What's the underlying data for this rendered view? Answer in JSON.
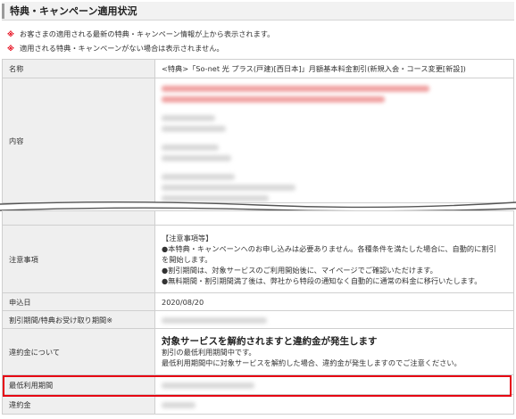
{
  "title": "特典・キャンペーン適用状況",
  "notes": [
    {
      "mark": "※",
      "text": "お客さまの適用される最新の特典・キャンペーン情報が上から表示されます。"
    },
    {
      "mark": "※",
      "text": "適用される特典・キャンペーンがない場合は表示されません。"
    }
  ],
  "rows_top": {
    "name_label": "名称",
    "name_value": "<特典>「So-net 光 プラス(戸建)[西日本]」月額基本料金割引(新規入会・コース変更[新設])",
    "content_label": "内容"
  },
  "rows_bottom": {
    "notice_label": "注意事項",
    "notice_lines": [
      "【注意事項等】",
      "●本特典・キャンペーンへのお申し込みは必要ありません。各種条件を満たした場合に、自動的に割引",
      "を開始します。",
      "●割引期間は、対象サービスのご利用開始後に、マイページでご確認いただけます。",
      "●無料期間・割引期間満了後は、弊社から特段の通知なく自動的に通常の料金に移行いたします。"
    ],
    "apply_date_label": "申込日",
    "apply_date_value": "2020/08/20",
    "period_label": "割引期間/特典お受け取り期間※",
    "penalty_label": "違約金について",
    "penalty_heading": "対象サービスを解約されますと違約金が発生します",
    "penalty_line1": "割引の最低利用期間中です。",
    "penalty_line2": "最低利用期間中に対象サービスを解約した場合、違約金が発生しますのでご注意ください。",
    "min_period_label": "最低利用期間",
    "fee_label": "違約金"
  },
  "colors": {
    "accent_red": "#e60012",
    "label_bg": "#efefef",
    "border": "#cfcfcf"
  }
}
